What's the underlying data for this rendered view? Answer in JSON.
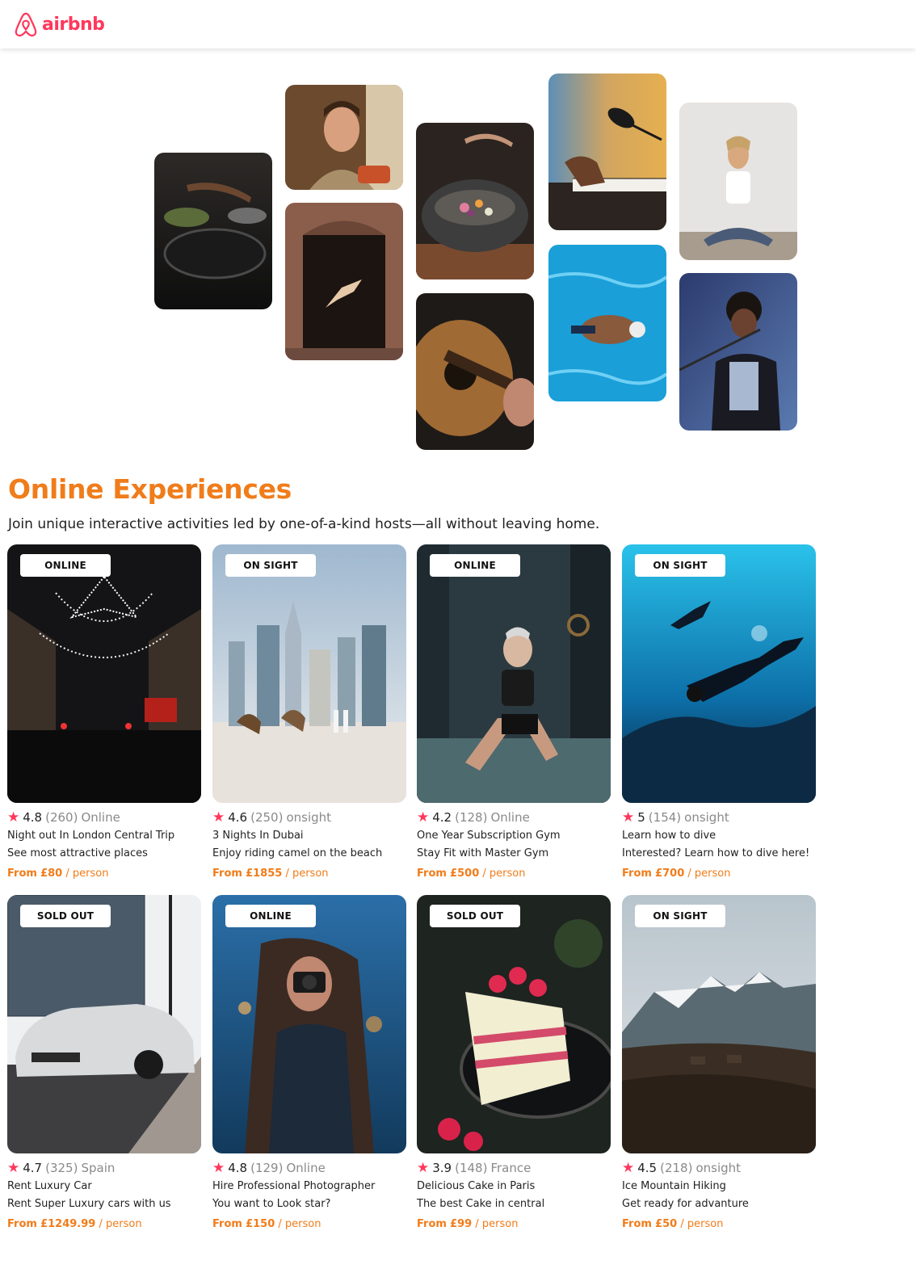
{
  "brand": {
    "logo_text": "airbnb",
    "accent": "#ff385c",
    "orange": "#f07c1a",
    "logo_icon": "airbnb-belo-icon"
  },
  "section": {
    "title": "Online Experiences",
    "subtitle": "Join unique interactive activities led by one-of-a-kind hosts—all without leaving home."
  },
  "price_prefix": "From",
  "star_icon": "star-icon",
  "cards": [
    {
      "badge": "ONLINE",
      "rating": "4.8",
      "reviews": "(260)",
      "location": "Online",
      "title": "Night out In London Central Trip",
      "description": "See most attractive places",
      "price": "£80",
      "unit": "/ person"
    },
    {
      "badge": "ON SIGHT",
      "rating": "4.6",
      "reviews": "(250)",
      "location": "onsight",
      "title": "3 Nights In Dubai",
      "description": "Enjoy riding camel on the beach",
      "price": "£1855",
      "unit": "/ person"
    },
    {
      "badge": "ONLINE",
      "rating": "4.2",
      "reviews": "(128)",
      "location": "Online",
      "title": "One Year Subscription Gym",
      "description": "Stay Fit with Master Gym",
      "price": "£500",
      "unit": "/ person"
    },
    {
      "badge": "ON SIGHT",
      "rating": "5",
      "reviews": "(154)",
      "location": "onsight",
      "title": "Learn how to dive",
      "description": "Interested? Learn how to dive here!",
      "price": "£700",
      "unit": "/ person"
    },
    {
      "badge": "SOLD OUT",
      "rating": "4.7",
      "reviews": "(325)",
      "location": "Spain",
      "title": "Rent Luxury Car",
      "description": "Rent Super Luxury cars with us",
      "price": "£1249.99",
      "unit": "/ person"
    },
    {
      "badge": "ONLINE",
      "rating": "4.8",
      "reviews": "(129)",
      "location": "Online",
      "title": "Hire Professional Photographer",
      "description": "You want to Look star?",
      "price": "£150",
      "unit": "/ person"
    },
    {
      "badge": "SOLD OUT",
      "rating": "3.9",
      "reviews": "(148)",
      "location": "France",
      "title": "Delicious Cake in Paris",
      "description": "The best Cake in central",
      "price": "£99",
      "unit": "/ person"
    },
    {
      "badge": "ON SIGHT",
      "rating": "4.5",
      "reviews": "(218)",
      "location": "onsight",
      "title": "Ice Mountain Hiking",
      "description": "Get ready for advanture",
      "price": "£50",
      "unit": "/ person"
    }
  ]
}
